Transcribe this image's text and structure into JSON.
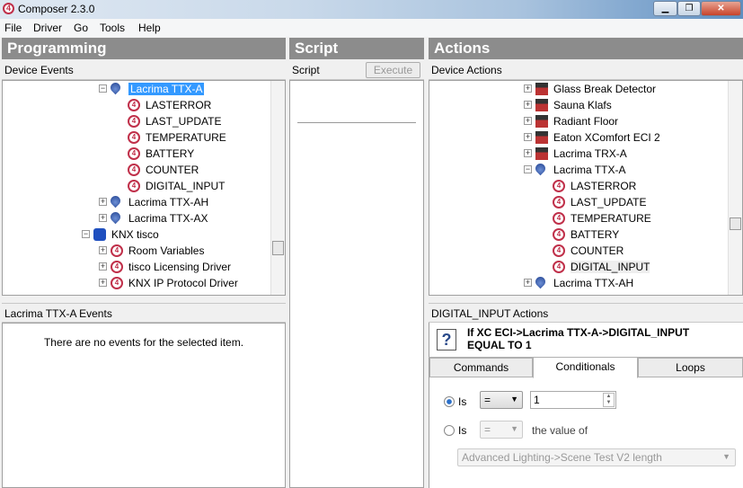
{
  "window": {
    "title": "Composer 2.3.0",
    "minimize": "▁",
    "maximize": "❐",
    "close": "✕"
  },
  "menu": [
    "File",
    "Driver",
    "Go",
    "Tools",
    "Help"
  ],
  "programming": {
    "title": "Programming",
    "subheader": "Device Events",
    "tree": [
      {
        "label": "Lacrima TTX-A",
        "icon": "water-drop-icon",
        "level": 2,
        "expander": "−",
        "selected": true
      },
      {
        "label": "LASTERROR",
        "icon": "event-icon",
        "level": 3
      },
      {
        "label": "LAST_UPDATE",
        "icon": "event-icon",
        "level": 3
      },
      {
        "label": "TEMPERATURE",
        "icon": "event-icon",
        "level": 3
      },
      {
        "label": "BATTERY",
        "icon": "event-icon",
        "level": 3
      },
      {
        "label": "COUNTER",
        "icon": "event-icon",
        "level": 3
      },
      {
        "label": "DIGITAL_INPUT",
        "icon": "event-icon",
        "level": 3
      },
      {
        "label": "Lacrima TTX-AH",
        "icon": "water-drop-icon",
        "level": 2,
        "expander": "+"
      },
      {
        "label": "Lacrima TTX-AX",
        "icon": "water-drop-icon",
        "level": 2,
        "expander": "+"
      },
      {
        "label": "KNX tisco",
        "icon": "knx-icon",
        "level": 1,
        "expander": "−"
      },
      {
        "label": "Room Variables",
        "icon": "event-icon",
        "level": 2,
        "expander": "+"
      },
      {
        "label": "tisco Licensing Driver",
        "icon": "event-icon",
        "level": 2,
        "expander": "+"
      },
      {
        "label": "KNX IP Protocol Driver",
        "icon": "event-icon",
        "level": 2,
        "expander": "+"
      }
    ],
    "events_header": "Lacrima TTX-A Events",
    "events_empty": "There are no events for the selected item."
  },
  "script": {
    "title": "Script",
    "subheader": "Script",
    "execute": "Execute"
  },
  "actions": {
    "title": "Actions",
    "subheader": "Device Actions",
    "tree": [
      {
        "label": "Glass Break Detector",
        "icon": "glass-break-icon",
        "level": 0,
        "expander": "+"
      },
      {
        "label": "Sauna Klafs",
        "icon": "device-icon",
        "level": 0,
        "expander": "+"
      },
      {
        "label": "Radiant Floor",
        "icon": "radiant-floor-icon",
        "level": 0,
        "expander": "+"
      },
      {
        "label": "Eaton XComfort ECI 2",
        "icon": "device-icon",
        "level": 0,
        "expander": "+"
      },
      {
        "label": "Lacrima TRX-A",
        "icon": "device-icon",
        "level": 0,
        "expander": "+"
      },
      {
        "label": "Lacrima TTX-A",
        "icon": "water-drop-icon",
        "level": 0,
        "expander": "−"
      },
      {
        "label": "LASTERROR",
        "icon": "event-icon",
        "level": 1
      },
      {
        "label": "LAST_UPDATE",
        "icon": "event-icon",
        "level": 1
      },
      {
        "label": "TEMPERATURE",
        "icon": "event-icon",
        "level": 1
      },
      {
        "label": "BATTERY",
        "icon": "event-icon",
        "level": 1
      },
      {
        "label": "COUNTER",
        "icon": "event-icon",
        "level": 1
      },
      {
        "label": "DIGITAL_INPUT",
        "icon": "event-icon",
        "level": 1,
        "hover": true
      },
      {
        "label": "Lacrima TTX-AH",
        "icon": "water-drop-icon",
        "level": 0,
        "expander": "+"
      }
    ],
    "detail_header": "DIGITAL_INPUT Actions",
    "condition_line1": "If XC ECI->Lacrima TTX-A->DIGITAL_INPUT",
    "condition_line2": "EQUAL TO 1",
    "tabs": [
      "Commands",
      "Conditionals",
      "Loops"
    ],
    "active_tab": "Conditionals",
    "is_label": "Is",
    "operator": "=",
    "value": "1",
    "is_label2": "Is",
    "operator2": "=",
    "value_of": "the value of",
    "variable": "Advanced Lighting->Scene Test V2 length"
  }
}
